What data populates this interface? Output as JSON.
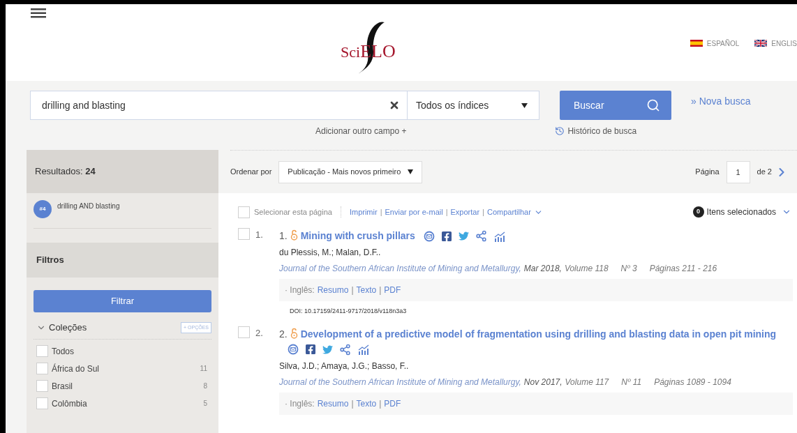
{
  "header": {
    "languages": [
      {
        "label": "ESPAÑOL"
      },
      {
        "label": "ENGLIS"
      }
    ],
    "logo": {
      "prefix": "Sci",
      "suffix": "ELO"
    }
  },
  "search": {
    "value": "drilling and blasting",
    "index": "Todos os índices",
    "button": "Buscar",
    "new_search": "» Nova busca",
    "add_field": "Adicionar outro campo +",
    "history": "Histórico de busca"
  },
  "sidebar": {
    "results_label": "Resultados:",
    "results_count": "24",
    "query_badge": "#4",
    "query": "drilling AND blasting",
    "filters_title": "Filtros",
    "filter_button": "Filtrar",
    "collections": {
      "title": "Coleções",
      "expanded": true,
      "options": "+ OPÇÕES",
      "items": [
        {
          "label": "Todos",
          "checked": false
        },
        {
          "label": "África do Sul",
          "count": "11",
          "checked": false
        },
        {
          "label": "Brasil",
          "count": "8",
          "checked": false
        },
        {
          "label": "Colômbia",
          "count": "5",
          "checked": false
        }
      ]
    }
  },
  "toolbar": {
    "sort_label": "Ordenar por",
    "sort_value": "Publicação - Mais novos primeiro",
    "page_label": "Página",
    "page": "1",
    "page_total": "de 2"
  },
  "actions": {
    "select_page": {
      "label": "Selecionar esta página",
      "checked": false
    },
    "links": [
      "Imprimir",
      "Enviar por e-mail",
      "Exportar",
      "Compartilhar"
    ],
    "separator": "|",
    "selected_count": "0",
    "selected_label": "Itens selecionados"
  },
  "results": [
    {
      "checked": false,
      "index": "1.",
      "number": "1.",
      "title": "Mining with crush pillars",
      "authors": "du Plessis, M.; Malan, D.F..",
      "journal": "Journal of the Southern African Institute of Mining and Metallurgy,",
      "date": "Mar 2018,",
      "volume": "Volume 118",
      "issue": "Nº 3",
      "pages": "Páginas 211 - 216",
      "language": "· Inglês:",
      "links": [
        "Resumo",
        "Texto",
        "PDF"
      ],
      "separator": "|",
      "doi": "DOI: 10.17159/2411-9717/2018/v118n3a3"
    },
    {
      "checked": false,
      "index": "2.",
      "number": "2.",
      "title": "Development of a predictive model of fragmentation using drilling and blasting data in open pit mining",
      "authors": "Silva, J.D.; Amaya, J.G.; Basso, F..",
      "journal": "Journal of the Southern African Institute of Mining and Metallurgy,",
      "date": "Nov 2017,",
      "volume": "Volume 117",
      "issue": "Nº 11",
      "pages": "Páginas 1089 - 1094",
      "language": "· Inglês:",
      "links": [
        "Resumo",
        "Texto",
        "PDF"
      ],
      "separator": "|"
    }
  ]
}
